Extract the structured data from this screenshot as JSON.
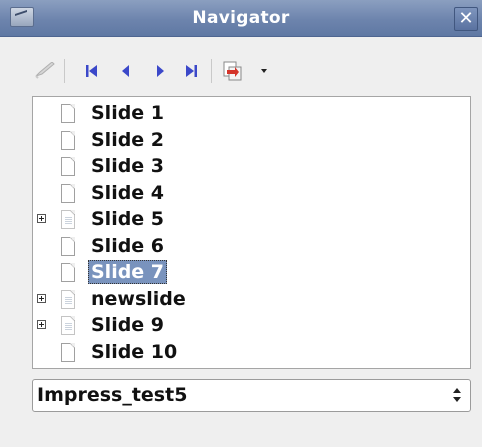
{
  "window": {
    "title": "Navigator",
    "close_glyph": "✕"
  },
  "toolbar": {
    "buttons": [
      {
        "name": "pen-icon",
        "enabled": false
      },
      {
        "name": "first-slide-icon",
        "enabled": true
      },
      {
        "name": "previous-slide-icon",
        "enabled": true
      },
      {
        "name": "next-slide-icon",
        "enabled": true
      },
      {
        "name": "last-slide-icon",
        "enabled": true
      },
      {
        "name": "drag-mode-icon",
        "enabled": true
      },
      {
        "name": "drag-mode-dropdown-icon",
        "enabled": true
      }
    ],
    "accent_color": "#3b48c9"
  },
  "tree": {
    "items": [
      {
        "label": "Slide 1",
        "expandable": false,
        "has_objects": false,
        "selected": false
      },
      {
        "label": "Slide 2",
        "expandable": false,
        "has_objects": false,
        "selected": false
      },
      {
        "label": "Slide 3",
        "expandable": false,
        "has_objects": false,
        "selected": false
      },
      {
        "label": "Slide 4",
        "expandable": false,
        "has_objects": false,
        "selected": false
      },
      {
        "label": "Slide 5",
        "expandable": true,
        "has_objects": true,
        "selected": false
      },
      {
        "label": "Slide 6",
        "expandable": false,
        "has_objects": false,
        "selected": false
      },
      {
        "label": "Slide 7",
        "expandable": false,
        "has_objects": false,
        "selected": true
      },
      {
        "label": "newslide",
        "expandable": true,
        "has_objects": true,
        "selected": false
      },
      {
        "label": "Slide 9",
        "expandable": true,
        "has_objects": true,
        "selected": false
      },
      {
        "label": "Slide 10",
        "expandable": false,
        "has_objects": false,
        "selected": false
      }
    ],
    "selection_color": "#7993bd"
  },
  "document_select": {
    "value": "Impress_test5"
  }
}
